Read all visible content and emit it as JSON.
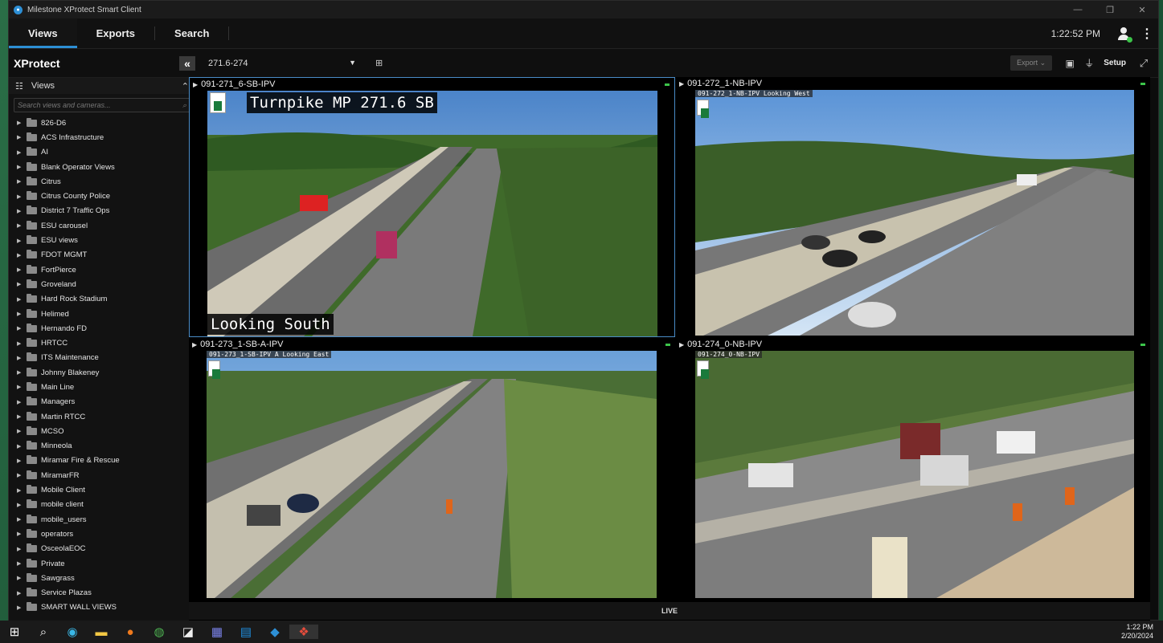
{
  "window": {
    "title": "Milestone XProtect Smart Client"
  },
  "topnav": {
    "tabs": [
      {
        "label": "Views",
        "active": true
      },
      {
        "label": "Exports",
        "active": false
      },
      {
        "label": "Search",
        "active": false
      }
    ],
    "clock": "1:22:52 PM"
  },
  "subbar": {
    "brand": "XProtect",
    "current_view": "271.6-274",
    "export_label": "Export",
    "setup_label": "Setup"
  },
  "sidebar": {
    "header": "Views",
    "search_placeholder": "Search views and cameras...",
    "items": [
      "826-D6",
      "ACS Infrastructure",
      "AI",
      "Blank Operator Views",
      "Citrus",
      "Citrus County Police",
      "District 7 Traffic Ops",
      "ESU carousel",
      "ESU views",
      "FDOT MGMT",
      "FortPierce",
      "Groveland",
      "Hard Rock Stadium",
      "Helimed",
      "Hernando FD",
      "HRTCC",
      "ITS Maintenance",
      "Johnny Blakeney",
      "Main Line",
      "Managers",
      "Martin RTCC",
      "MCSO",
      "Minneola",
      "Miramar Fire & Rescue",
      "MiramarFR",
      "Mobile Client",
      "mobile client",
      "mobile_users",
      "operators",
      "OsceolaEOC",
      "Private",
      "Sawgrass",
      "Service Plazas",
      "SMART WALL VIEWS"
    ]
  },
  "cameras": [
    {
      "name": "091-271_6-SB-IPV",
      "osd_top": "Turnpike MP 271.6 SB",
      "osd_bottom": "Looking South"
    },
    {
      "name": "091-272_1-NB-IPV",
      "osd_top": "091-272_1-NB-IPV Looking West"
    },
    {
      "name": "091-273_1-SB-A-IPV",
      "osd_top": "091-273_1-SB-IPV A Looking East"
    },
    {
      "name": "091-274_0-NB-IPV",
      "osd_top": "091-274_0-NB-IPV"
    }
  ],
  "status": {
    "live_label": "LIVE"
  },
  "taskbar": {
    "time": "1:22 PM",
    "date": "2/20/2024"
  },
  "colors": {
    "accent": "#2d8fd5",
    "selected_border": "#4a8cc7",
    "recording": "#3cc44a"
  }
}
